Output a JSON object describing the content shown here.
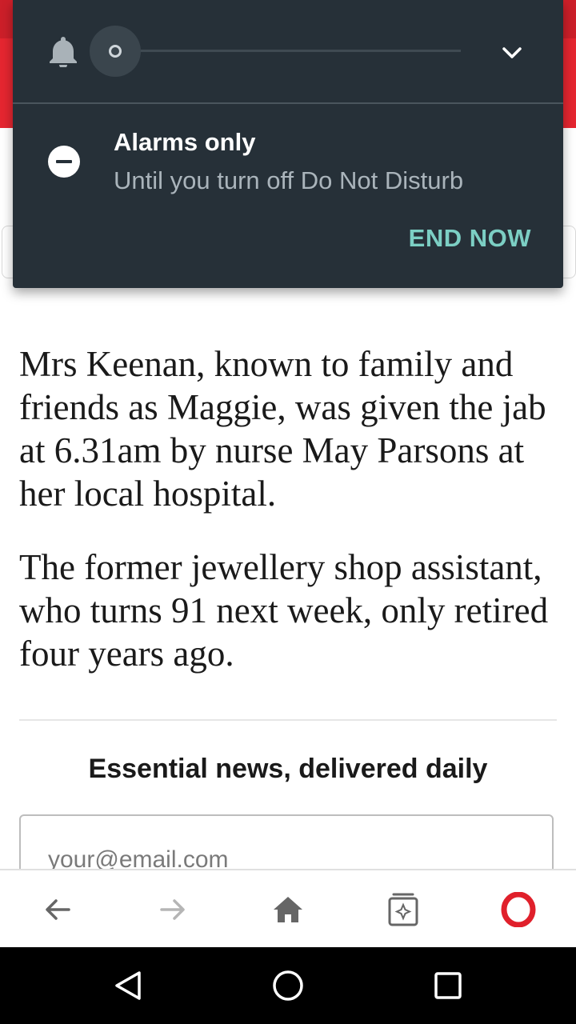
{
  "dnd_panel": {
    "mode_title": "Alarms only",
    "mode_subtitle": "Until you turn off Do Not Disturb",
    "end_now_label": "END NOW"
  },
  "article": {
    "paragraphs": [
      "Mrs Keenan, known to family and friends as Maggie, was given the jab at 6.31am by nurse May Parsons at her local hospital.",
      "The former jewellery shop assistant, who turns 91 next week, only retired four years ago."
    ]
  },
  "newsletter": {
    "heading": "Essential news, delivered daily",
    "email_placeholder": "your@email.com"
  },
  "browser_bar": {
    "icons": [
      "back-icon",
      "forward-icon",
      "home-icon",
      "tabs-icon",
      "opera-menu-icon"
    ]
  },
  "system_nav": {
    "icons": [
      "nav-back-icon",
      "nav-home-icon",
      "nav-recents-icon"
    ]
  },
  "colors": {
    "panel_bg": "#263038",
    "accent_teal": "#7ccfc4",
    "header_red": "#e52630",
    "opera_red": "#e0202b"
  }
}
